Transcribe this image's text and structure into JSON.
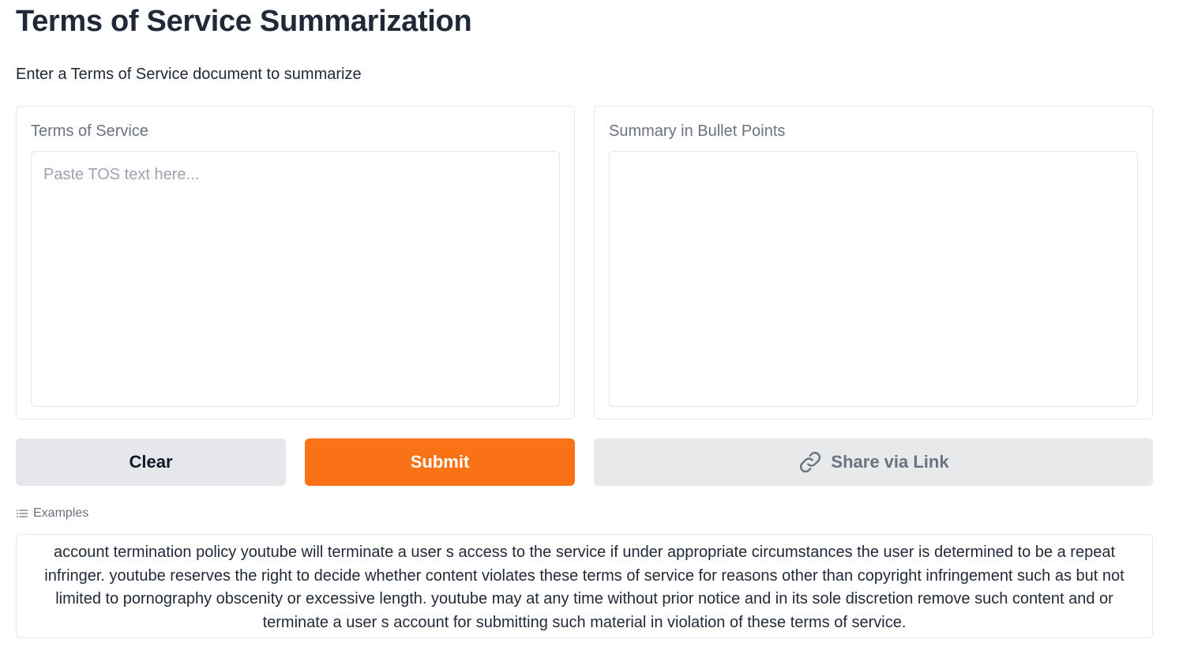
{
  "header": {
    "title": "Terms of Service Summarization",
    "description": "Enter a Terms of Service document to summarize"
  },
  "input_panel": {
    "label": "Terms of Service",
    "value": "",
    "placeholder": "Paste TOS text here..."
  },
  "output_panel": {
    "label": "Summary in Bullet Points",
    "value": ""
  },
  "buttons": {
    "clear": "Clear",
    "submit": "Submit",
    "share": "Share via Link",
    "share_icon": "link-icon"
  },
  "examples": {
    "label": "Examples",
    "icon": "list-icon",
    "items": [
      "account termination policy youtube will terminate a user s access to the service if under appropriate circumstances the user is determined to be a repeat infringer. youtube reserves the right to decide whether content violates these terms of service for reasons other than copyright infringement such as but not limited to pornography obscenity or excessive length. youtube may at any time without prior notice and in its sole discretion remove such content and or terminate a user s account for submitting such material in violation of these terms of service."
    ]
  },
  "colors": {
    "accent": "#f97316",
    "button_secondary": "#e5e7eb",
    "border": "#e5e7eb",
    "muted_text": "#6b7280"
  }
}
